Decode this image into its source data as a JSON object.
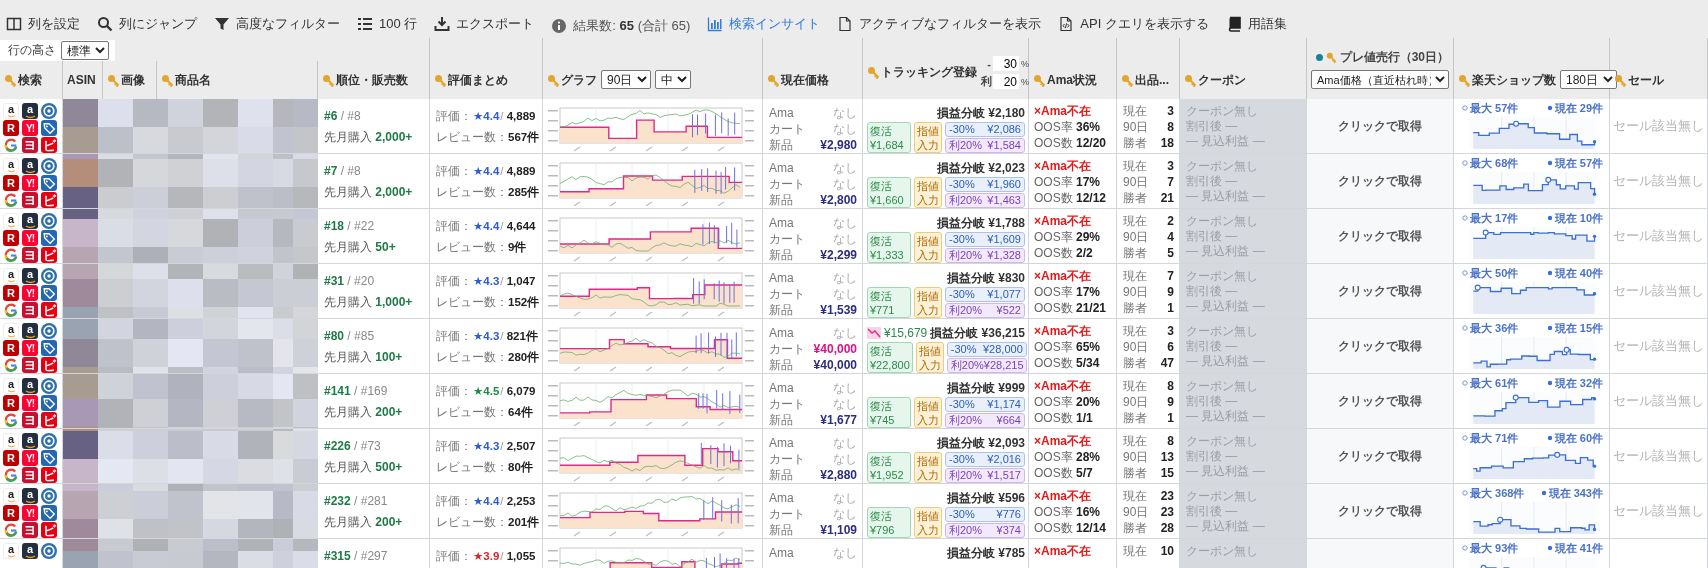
{
  "toolbar": [
    {
      "kind": "columns",
      "label": "列を設定",
      "active": false
    },
    {
      "kind": "search",
      "label": "列にジャンプ",
      "active": false
    },
    {
      "kind": "filter",
      "label": "高度なフィルター",
      "active": false
    },
    {
      "kind": "rows",
      "label": "100 行",
      "active": false
    },
    {
      "kind": "export",
      "label": "エクスポート",
      "active": false
    },
    {
      "kind": "info",
      "label": "結果数: **65** (合計 65)",
      "active": false
    },
    {
      "kind": "insight",
      "label": "検索インサイト",
      "active": true
    },
    {
      "kind": "document",
      "label": "アクティブなフィルターを表示",
      "active": false
    },
    {
      "kind": "code",
      "label": "API クエリを表示する",
      "active": false
    },
    {
      "kind": "book",
      "label": "用語集",
      "active": false
    }
  ],
  "row_height": {
    "label": "行の高さ",
    "value": "標準"
  },
  "columns": [
    {
      "kind": "plain",
      "label": "検索",
      "key": true
    },
    {
      "kind": "plain",
      "label": "ASIN",
      "key": false
    },
    {
      "kind": "plain",
      "label": "画像",
      "key": true
    },
    {
      "kind": "plain",
      "label": "商品名",
      "key": true
    },
    {
      "kind": "plain",
      "label": "順位・販売数",
      "key": true
    },
    {
      "kind": "plain",
      "label": "評価まとめ",
      "key": true
    },
    {
      "kind": "select",
      "label": "グラフ",
      "key": true,
      "selects": [
        "90日",
        "中"
      ]
    },
    {
      "kind": "plain",
      "label": "現在価格",
      "key": true
    },
    {
      "kind": "tracking",
      "label": "トラッキング登録",
      "key": true,
      "inputs": [
        {
          "prefix": "-",
          "value": "30",
          "suffix": "%"
        },
        {
          "prefix": "利",
          "value": "20",
          "suffix": "%"
        }
      ]
    },
    {
      "kind": "plain",
      "label": "Ama状況",
      "key": true
    },
    {
      "kind": "plain",
      "label": "出品...",
      "key": true
    },
    {
      "kind": "plain",
      "label": "クーポン",
      "key": true
    },
    {
      "kind": "premium",
      "label": "プレ値売行（30日）",
      "key": true,
      "dot": true,
      "selects": [
        "Ama価格（直近枯れ時）"
      ]
    },
    {
      "kind": "select",
      "label": "楽天ショップ数",
      "key": true,
      "selects": [
        "180日"
      ]
    },
    {
      "kind": "plain",
      "label": "セール",
      "key": true
    }
  ],
  "rows": [
    {
      "links": [
        {
          "kind": "amazon",
          "text": "a"
        },
        {
          "kind": "amazon-dark",
          "text": "a"
        },
        {
          "kind": "circle"
        },
        {
          "kind": "rakuten",
          "text": "R"
        },
        {
          "kind": "yahoo",
          "text": "Y!"
        },
        {
          "kind": "tag"
        },
        {
          "kind": "ring"
        },
        {
          "kind": "yodobashi",
          "text": "ヨ"
        },
        {
          "kind": "bic",
          "text": "ビ"
        }
      ],
      "image": {
        "kind": "picture"
      },
      "rank": "**#6** / #8",
      "monthly": "先月購入 **2,000+**",
      "rating": {
        "label": "評価：",
        "score": "★4.4",
        "color": "#2f5bd3",
        "count": "/ **4,889**"
      },
      "reviews": "レビュー数：**567件**",
      "prices": [
        {
          "label": "Ama",
          "value": "なし",
          "kind": "none"
        },
        {
          "label": "カート",
          "value": "なし",
          "kind": "none"
        },
        {
          "label": "新品",
          "value": "¥2,980",
          "kind": "price"
        }
      ],
      "tracking": {
        "breakeven": "損益分岐 ¥2,180",
        "revive": [
          "復活",
          "¥1,684"
        ],
        "limit": [
          "指値",
          "入力"
        ],
        "discount": [
          "-30%",
          "¥2,086"
        ],
        "profit": [
          "利20%",
          "¥1,584"
        ]
      },
      "ama": {
        "status": "×Ama不在",
        "lines": [
          "OOS率 **36%**",
          "OOS数 **12/20**"
        ]
      },
      "offers": [
        {
          "label": "現在",
          "value": "3"
        },
        {
          "label": "90日",
          "value": "8"
        },
        {
          "label": "勝者",
          "value": "18"
        }
      ],
      "coupon": [
        "クーポン無し",
        "割引後 —",
        "— 見込利益 —"
      ],
      "premium": "クリックで取得",
      "rakuten": {
        "max": "最大 57件",
        "now": "現在 29件"
      },
      "sale": "セール該当無し"
    },
    {
      "links": [
        {
          "kind": "amazon",
          "text": "a"
        },
        {
          "kind": "amazon-dark",
          "text": "a"
        },
        {
          "kind": "circle"
        },
        {
          "kind": "rakuten",
          "text": "R"
        },
        {
          "kind": "yahoo",
          "text": "Y!"
        },
        {
          "kind": "tag"
        },
        {
          "kind": "ring"
        },
        {
          "kind": "yodobashi",
          "text": "ヨ"
        },
        {
          "kind": "bic",
          "text": "ビ"
        }
      ],
      "image": {
        "kind": "picture"
      },
      "rank": "**#7** / #8",
      "monthly": "先月購入 **2,000+**",
      "rating": {
        "label": "評価：",
        "score": "★4.4",
        "color": "#2f5bd3",
        "count": "/ **4,889**"
      },
      "reviews": "レビュー数：**285件**",
      "prices": [
        {
          "label": "Ama",
          "value": "なし",
          "kind": "none"
        },
        {
          "label": "カート",
          "value": "なし",
          "kind": "none"
        },
        {
          "label": "新品",
          "value": "¥2,800",
          "kind": "price"
        }
      ],
      "tracking": {
        "breakeven": "損益分岐 ¥2,023",
        "revive": [
          "復活",
          "¥1,660"
        ],
        "limit": [
          "指値",
          "入力"
        ],
        "discount": [
          "-30%",
          "¥1,960"
        ],
        "profit": [
          "利20%",
          "¥1,463"
        ]
      },
      "ama": {
        "status": "×Ama不在",
        "lines": [
          "OOS率 **17%**",
          "OOS数 **12/12**"
        ]
      },
      "offers": [
        {
          "label": "現在",
          "value": "3"
        },
        {
          "label": "90日",
          "value": "7"
        },
        {
          "label": "勝者",
          "value": "21"
        }
      ],
      "coupon": [
        "クーポン無し",
        "割引後 —",
        "— 見込利益 —"
      ],
      "premium": "クリックで取得",
      "rakuten": {
        "max": "最大 68件",
        "now": "現在 57件"
      },
      "sale": "セール該当無し"
    },
    {
      "links": [
        {
          "kind": "amazon",
          "text": "a"
        },
        {
          "kind": "amazon-dark",
          "text": "a"
        },
        {
          "kind": "circle"
        },
        {
          "kind": "rakuten",
          "text": "R"
        },
        {
          "kind": "yahoo",
          "text": "Y!"
        },
        {
          "kind": "tag"
        },
        {
          "kind": "ring"
        },
        {
          "kind": "yodobashi",
          "text": "ヨ"
        },
        {
          "kind": "bic",
          "text": "ビ"
        }
      ],
      "image": {
        "kind": "picture"
      },
      "rank": "**#18** / #22",
      "monthly": "先月購入 **50+**",
      "rating": {
        "label": "評価：",
        "score": "★4.4",
        "color": "#2f5bd3",
        "count": "/ **4,644**"
      },
      "reviews": "レビュー数：**9件**",
      "prices": [
        {
          "label": "Ama",
          "value": "なし",
          "kind": "none"
        },
        {
          "label": "カート",
          "value": "なし",
          "kind": "none"
        },
        {
          "label": "新品",
          "value": "¥2,299",
          "kind": "price"
        }
      ],
      "tracking": {
        "breakeven": "損益分岐 ¥1,788",
        "revive": [
          "復活",
          "¥1,333"
        ],
        "limit": [
          "指値",
          "入力"
        ],
        "discount": [
          "-30%",
          "¥1,609"
        ],
        "profit": [
          "利20%",
          "¥1,328"
        ]
      },
      "ama": {
        "status": "×Ama不在",
        "lines": [
          "OOS率 **29%**",
          "OOS数 **2/2**"
        ]
      },
      "offers": [
        {
          "label": "現在",
          "value": "2"
        },
        {
          "label": "90日",
          "value": "4"
        },
        {
          "label": "勝者",
          "value": "5"
        }
      ],
      "coupon": [
        "クーポン無し",
        "割引後 —",
        "— 見込利益 —"
      ],
      "premium": "クリックで取得",
      "rakuten": {
        "max": "最大 17件",
        "now": "現在 10件"
      },
      "sale": "セール該当無し"
    },
    {
      "links": [
        {
          "kind": "amazon",
          "text": "a"
        },
        {
          "kind": "amazon-dark",
          "text": "a"
        },
        {
          "kind": "circle"
        },
        {
          "kind": "rakuten",
          "text": "R"
        },
        {
          "kind": "yahoo",
          "text": "Y!"
        },
        {
          "kind": "tag"
        },
        {
          "kind": "ring"
        },
        {
          "kind": "yodobashi",
          "text": "ヨ"
        },
        {
          "kind": "bic",
          "text": "ビ"
        }
      ],
      "image": {
        "kind": "picture"
      },
      "rank": "**#31** / #20",
      "monthly": "先月購入 **1,000+**",
      "rating": {
        "label": "評価：",
        "score": "★4.3",
        "color": "#2f5bd3",
        "count": "/ **1,047**"
      },
      "reviews": "レビュー数：**152件**",
      "prices": [
        {
          "label": "Ama",
          "value": "なし",
          "kind": "none"
        },
        {
          "label": "カート",
          "value": "なし",
          "kind": "none"
        },
        {
          "label": "新品",
          "value": "¥1,539",
          "kind": "price"
        }
      ],
      "tracking": {
        "breakeven": "損益分岐 ¥830",
        "revive": [
          "復活",
          "¥771"
        ],
        "limit": [
          "指値",
          "入力"
        ],
        "discount": [
          "-30%",
          "¥1,077"
        ],
        "profit": [
          "利20%",
          "¥522"
        ]
      },
      "ama": {
        "status": "×Ama不在",
        "lines": [
          "OOS率 **17%**",
          "OOS数 **21/21**"
        ]
      },
      "offers": [
        {
          "label": "現在",
          "value": "7"
        },
        {
          "label": "90日",
          "value": "9"
        },
        {
          "label": "勝者",
          "value": "1"
        }
      ],
      "coupon": [
        "クーポン無し",
        "割引後 —",
        "— 見込利益 —"
      ],
      "premium": "クリックで取得",
      "rakuten": {
        "max": "最大 50件",
        "now": "現在 40件"
      },
      "sale": "セール該当無し"
    },
    {
      "links": [
        {
          "kind": "amazon",
          "text": "a"
        },
        {
          "kind": "amazon-dark",
          "text": "a"
        },
        {
          "kind": "circle"
        },
        {
          "kind": "rakuten",
          "text": "R"
        },
        {
          "kind": "yahoo",
          "text": "Y!"
        },
        {
          "kind": "tag"
        },
        {
          "kind": "ring"
        },
        {
          "kind": "yodobashi",
          "text": "ヨ"
        },
        {
          "kind": "bic",
          "text": "ビ"
        }
      ],
      "image": {
        "kind": "picture"
      },
      "rank": "**#80** / #85",
      "monthly": "先月購入 **100+**",
      "rating": {
        "label": "評価：",
        "score": "★4.3",
        "color": "#2f5bd3",
        "count": "/ **821件**"
      },
      "reviews": "レビュー数：**280件**",
      "prices": [
        {
          "label": "Ama",
          "value": "なし",
          "kind": "none"
        },
        {
          "label": "カート",
          "value": "¥40,000",
          "kind": "cart"
        },
        {
          "label": "新品",
          "value": "¥40,000",
          "kind": "price"
        }
      ],
      "tracking": {
        "drop": "¥15,679",
        "breakeven": "損益分岐 ¥36,215",
        "revive": [
          "復活",
          "¥22,800"
        ],
        "limit": [
          "指値",
          "入力"
        ],
        "discount": [
          "-30%",
          "¥28,000"
        ],
        "profit": [
          "利20%",
          "¥28,215"
        ]
      },
      "ama": {
        "status": "×Ama不在",
        "lines": [
          "OOS率 **65%**",
          "OOS数 **5/34**"
        ]
      },
      "offers": [
        {
          "label": "現在",
          "value": "3"
        },
        {
          "label": "90日",
          "value": "6"
        },
        {
          "label": "勝者",
          "value": "47"
        }
      ],
      "coupon": [
        "クーポン無し",
        "割引後 —",
        "— 見込利益 —"
      ],
      "premium": "クリックで取得",
      "rakuten": {
        "max": "最大 36件",
        "now": "現在 15件"
      },
      "sale": "セール該当無し"
    },
    {
      "links": [
        {
          "kind": "amazon",
          "text": "a"
        },
        {
          "kind": "amazon-dark",
          "text": "a"
        },
        {
          "kind": "circle"
        },
        {
          "kind": "rakuten",
          "text": "R"
        },
        {
          "kind": "yahoo",
          "text": "Y!"
        },
        {
          "kind": "tag"
        },
        {
          "kind": "ring"
        },
        {
          "kind": "yodobashi",
          "text": "ヨ"
        },
        {
          "kind": "bic",
          "text": "ビ"
        }
      ],
      "image": {
        "kind": "picture"
      },
      "rank": "**#141** / #169",
      "monthly": "先月購入 **200+**",
      "rating": {
        "label": "評価：",
        "score": "★4.5",
        "color": "#1e8a4c",
        "count": "/ **6,079**"
      },
      "reviews": "レビュー数：**64件**",
      "prices": [
        {
          "label": "Ama",
          "value": "なし",
          "kind": "none"
        },
        {
          "label": "カート",
          "value": "なし",
          "kind": "none"
        },
        {
          "label": "新品",
          "value": "¥1,677",
          "kind": "price"
        }
      ],
      "tracking": {
        "breakeven": "損益分岐 ¥999",
        "revive": [
          "復活",
          "¥745"
        ],
        "limit": [
          "指値",
          "入力"
        ],
        "discount": [
          "-30%",
          "¥1,174"
        ],
        "profit": [
          "利20%",
          "¥664"
        ]
      },
      "ama": {
        "status": "×Ama不在",
        "lines": [
          "OOS率 **20%**",
          "OOS数 **1/1**"
        ]
      },
      "offers": [
        {
          "label": "現在",
          "value": "8"
        },
        {
          "label": "90日",
          "value": "9"
        },
        {
          "label": "勝者",
          "value": "1"
        }
      ],
      "coupon": [
        "クーポン無し",
        "割引後 —",
        "— 見込利益 —"
      ],
      "premium": "クリックで取得",
      "rakuten": {
        "max": "最大 61件",
        "now": "現在 32件"
      },
      "sale": "セール該当無し"
    },
    {
      "links": [
        {
          "kind": "amazon",
          "text": "a"
        },
        {
          "kind": "amazon-dark",
          "text": "a"
        },
        {
          "kind": "circle"
        },
        {
          "kind": "rakuten",
          "text": "R"
        },
        {
          "kind": "yahoo",
          "text": "Y!"
        },
        {
          "kind": "tag"
        },
        {
          "kind": "ring"
        },
        {
          "kind": "yodobashi",
          "text": "ヨ"
        },
        {
          "kind": "bic",
          "text": "ビ"
        }
      ],
      "image": {
        "kind": "picture"
      },
      "rank": "**#226** / #73",
      "monthly": "先月購入 **500+**",
      "rating": {
        "label": "評価：",
        "score": "★4.3",
        "color": "#2f5bd3",
        "count": "/ **2,507**"
      },
      "reviews": "レビュー数：**80件**",
      "prices": [
        {
          "label": "Ama",
          "value": "なし",
          "kind": "none"
        },
        {
          "label": "カート",
          "value": "なし",
          "kind": "none"
        },
        {
          "label": "新品",
          "value": "¥2,880",
          "kind": "price"
        }
      ],
      "tracking": {
        "breakeven": "損益分岐 ¥2,093",
        "revive": [
          "復活",
          "¥1,952"
        ],
        "limit": [
          "指値",
          "入力"
        ],
        "discount": [
          "-30%",
          "¥2,016"
        ],
        "profit": [
          "利20%",
          "¥1,517"
        ]
      },
      "ama": {
        "status": "×Ama不在",
        "lines": [
          "OOS率 **28%**",
          "OOS数 **5/7**"
        ]
      },
      "offers": [
        {
          "label": "現在",
          "value": "8"
        },
        {
          "label": "90日",
          "value": "13"
        },
        {
          "label": "勝者",
          "value": "15"
        }
      ],
      "coupon": [
        "クーポン無し",
        "割引後 —",
        "— 見込利益 —"
      ],
      "premium": "クリックで取得",
      "rakuten": {
        "max": "最大 71件",
        "now": "現在 60件"
      },
      "sale": "セール該当無し"
    },
    {
      "links": [
        {
          "kind": "amazon",
          "text": "a"
        },
        {
          "kind": "amazon-dark",
          "text": "a"
        },
        {
          "kind": "circle"
        },
        {
          "kind": "rakuten",
          "text": "R"
        },
        {
          "kind": "yahoo",
          "text": "Y!"
        },
        {
          "kind": "tag"
        },
        {
          "kind": "ring"
        },
        {
          "kind": "yodobashi",
          "text": "ヨ"
        },
        {
          "kind": "bic",
          "text": "ビ"
        }
      ],
      "image": {
        "kind": "picture"
      },
      "rank": "**#232** / #281",
      "monthly": "先月購入 **200+**",
      "rating": {
        "label": "評価：",
        "score": "★4.4",
        "color": "#2f5bd3",
        "count": "/ **2,253**"
      },
      "reviews": "レビュー数：**201件**",
      "prices": [
        {
          "label": "Ama",
          "value": "なし",
          "kind": "none"
        },
        {
          "label": "カート",
          "value": "なし",
          "kind": "none"
        },
        {
          "label": "新品",
          "value": "¥1,109",
          "kind": "price"
        }
      ],
      "tracking": {
        "breakeven": "損益分岐 ¥596",
        "revive": [
          "復活",
          "¥796"
        ],
        "limit": [
          "指値",
          "入力"
        ],
        "discount": [
          "-30%",
          "¥776"
        ],
        "profit": [
          "利20%",
          "¥374"
        ]
      },
      "ama": {
        "status": "×Ama不在",
        "lines": [
          "OOS率 **16%**",
          "OOS数 **12/14**"
        ]
      },
      "offers": [
        {
          "label": "現在",
          "value": "23"
        },
        {
          "label": "90日",
          "value": "23"
        },
        {
          "label": "勝者",
          "value": "28"
        }
      ],
      "coupon": [
        "クーポン無し",
        "割引後 —",
        "— 見込利益 —"
      ],
      "premium": "クリックで取得",
      "rakuten": {
        "max": "最大 368件",
        "now": "現在 343件"
      },
      "sale": "セール該当無し"
    },
    {
      "links": [
        {
          "kind": "amazon",
          "text": "a"
        },
        {
          "kind": "amazon-dark",
          "text": "a"
        },
        {
          "kind": "circle"
        }
      ],
      "image": {
        "kind": "picture"
      },
      "rank": "**#315** / #297",
      "rating": {
        "label": "評価：",
        "score": "★3.9",
        "color": "#d62828",
        "count": "/ **1,055**"
      },
      "prices": [
        {
          "label": "Ama",
          "value": "なし",
          "kind": "none"
        }
      ],
      "tracking": {
        "breakeven": "損益分岐 ¥785"
      },
      "ama": {
        "status": "×Ama不在"
      },
      "offers": [
        {
          "label": "現在",
          "value": "10"
        }
      ],
      "coupon": [
        "クーポン無し"
      ],
      "rakuten": {
        "max": "最大 93件",
        "now": "現在 41件"
      }
    }
  ]
}
